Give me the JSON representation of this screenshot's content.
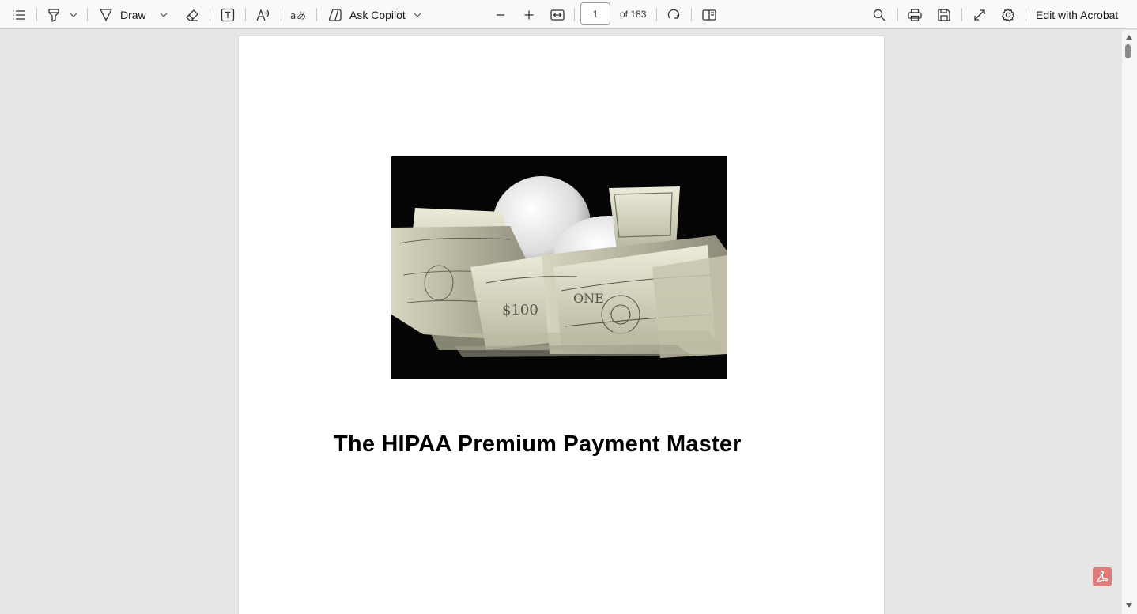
{
  "toolbar": {
    "contents_icon": "list-icon",
    "highlight_icon": "highlighter-icon",
    "draw_label": "Draw",
    "eraser_icon": "eraser-icon",
    "text_icon": "text-box-icon",
    "read_aloud_icon": "read-aloud-icon",
    "translate_icon": "translate-icon",
    "copilot_label": "Ask Copilot",
    "zoom_out_icon": "minus-icon",
    "zoom_in_icon": "plus-icon",
    "fit_icon": "fit-width-icon",
    "page_value": "1",
    "page_of": "of 183",
    "rotate_icon": "rotate-icon",
    "page_view_icon": "page-view-icon",
    "search_icon": "search-icon",
    "print_icon": "printer-icon",
    "save_icon": "save-icon",
    "fullscreen_icon": "expand-icon",
    "settings_icon": "gear-icon",
    "edit_acrobat_label": "Edit with Acrobat"
  },
  "document": {
    "title": "The HIPAA Premium Payment Master",
    "image": "money-nest-photo"
  },
  "colors": {
    "background": "#e6e6e6",
    "toolbar": "#f9f9f9",
    "acrobat_badge": "#e07b7b"
  }
}
